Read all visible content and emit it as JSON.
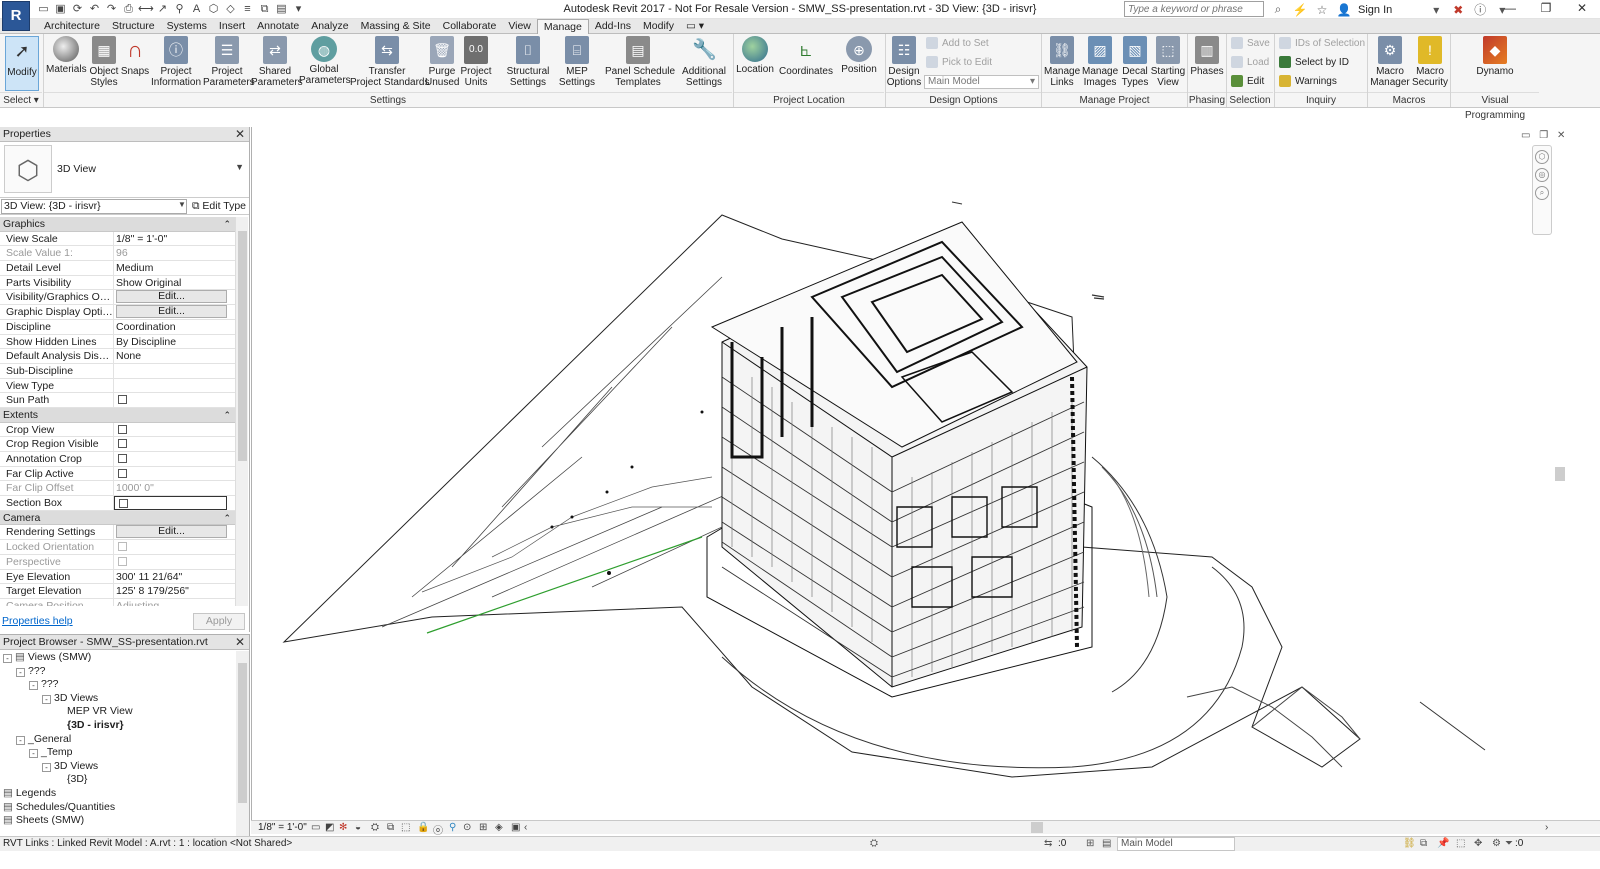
{
  "window": {
    "title": "Autodesk Revit 2017 - Not For Resale Version -    SMW_SS-presentation.rvt - 3D View: {3D - irisvr}",
    "search_placeholder": "Type a keyword or phrase",
    "sign_in": "Sign In",
    "app_button": "R"
  },
  "tabs": [
    "Architecture",
    "Structure",
    "Systems",
    "Insert",
    "Annotate",
    "Analyze",
    "Massing & Site",
    "Collaborate",
    "View",
    "Manage",
    "Add-Ins",
    "Modify"
  ],
  "active_tab": "Manage",
  "ribbon": {
    "modify": "Modify",
    "select": "Select",
    "settings_tools": [
      {
        "label1": "Materials",
        "label2": ""
      },
      {
        "label1": "Object",
        "label2": "Styles"
      },
      {
        "label1": "Snaps",
        "label2": ""
      },
      {
        "label1": "Project",
        "label2": "Information"
      },
      {
        "label1": "Project",
        "label2": "Parameters"
      },
      {
        "label1": "Shared",
        "label2": "Parameters"
      },
      {
        "label1": "Global",
        "label2": "Parameters"
      },
      {
        "label1": "Transfer",
        "label2": "Project Standards"
      },
      {
        "label1": "Purge",
        "label2": "Unused"
      },
      {
        "label1": "Project",
        "label2": "Units"
      },
      {
        "label1": "Structural",
        "label2": "Settings"
      },
      {
        "label1": "MEP",
        "label2": "Settings"
      },
      {
        "label1": "Panel Schedule",
        "label2": "Templates"
      },
      {
        "label1": "Additional",
        "label2": "Settings"
      }
    ],
    "location_tools": [
      {
        "label1": "Location",
        "label2": ""
      },
      {
        "label1": "Coordinates",
        "label2": ""
      },
      {
        "label1": "Position",
        "label2": ""
      }
    ],
    "design_options": {
      "label1": "Design",
      "label2": "Options",
      "add_to_set": "Add to Set",
      "pick_to_edit": "Pick to Edit",
      "main_model": "Main Model"
    },
    "manage_project_tools": [
      {
        "label1": "Manage",
        "label2": "Links"
      },
      {
        "label1": "Manage",
        "label2": "Images"
      },
      {
        "label1": "Decal",
        "label2": "Types"
      },
      {
        "label1": "Starting",
        "label2": "View"
      }
    ],
    "phases": "Phases",
    "selection": {
      "save": "Save",
      "load": "Load",
      "edit": "Edit"
    },
    "inquiry": {
      "ids": "IDs of Selection",
      "select_by_id": "Select by ID",
      "warnings": "Warnings"
    },
    "macros_tools": [
      {
        "label1": "Macro",
        "label2": "Manager"
      },
      {
        "label1": "Macro",
        "label2": "Security"
      }
    ],
    "dynamo": "Dynamo",
    "panels": {
      "settings": "Settings",
      "project_location": "Project Location",
      "design_options": "Design Options",
      "manage_project": "Manage Project",
      "phasing": "Phasing",
      "selection": "Selection",
      "inquiry": "Inquiry",
      "macros": "Macros",
      "visual_programming": "Visual Programming"
    }
  },
  "properties": {
    "title": "Properties",
    "type_name": "3D View",
    "instance": "3D View: {3D - irisvr}",
    "edit_type": "Edit Type",
    "groups": [
      {
        "name": "Graphics",
        "rows": [
          {
            "name": "View Scale",
            "value": "1/8\" = 1'-0\"",
            "kind": "text"
          },
          {
            "name": "Scale Value    1:",
            "value": "96",
            "kind": "text",
            "disabled": true
          },
          {
            "name": "Detail Level",
            "value": "Medium",
            "kind": "text"
          },
          {
            "name": "Parts Visibility",
            "value": "Show Original",
            "kind": "text"
          },
          {
            "name": "Visibility/Graphics Overri...",
            "value": "Edit...",
            "kind": "button"
          },
          {
            "name": "Graphic Display Options",
            "value": "Edit...",
            "kind": "button"
          },
          {
            "name": "Discipline",
            "value": "Coordination",
            "kind": "text"
          },
          {
            "name": "Show Hidden Lines",
            "value": "By Discipline",
            "kind": "text"
          },
          {
            "name": "Default Analysis Display ...",
            "value": "None",
            "kind": "text"
          },
          {
            "name": "Sub-Discipline",
            "value": "",
            "kind": "text"
          },
          {
            "name": "View Type",
            "value": "",
            "kind": "text"
          },
          {
            "name": "Sun Path",
            "value": "",
            "kind": "check"
          }
        ]
      },
      {
        "name": "Extents",
        "rows": [
          {
            "name": "Crop View",
            "value": "",
            "kind": "check"
          },
          {
            "name": "Crop Region Visible",
            "value": "",
            "kind": "check"
          },
          {
            "name": "Annotation Crop",
            "value": "",
            "kind": "check"
          },
          {
            "name": "Far Clip Active",
            "value": "",
            "kind": "check"
          },
          {
            "name": "Far Clip Offset",
            "value": "1000'  0\"",
            "kind": "text",
            "disabled": true
          },
          {
            "name": "Section Box",
            "value": "",
            "kind": "check-boxed"
          }
        ]
      },
      {
        "name": "Camera",
        "rows": [
          {
            "name": "Rendering Settings",
            "value": "Edit...",
            "kind": "button"
          },
          {
            "name": "Locked Orientation",
            "value": "",
            "kind": "check",
            "disabled": true
          },
          {
            "name": "Perspective",
            "value": "",
            "kind": "check",
            "disabled": true
          },
          {
            "name": "Eye Elevation",
            "value": "300'  11 21/64\"",
            "kind": "text"
          },
          {
            "name": "Target Elevation",
            "value": "125'  8 179/256\"",
            "kind": "text"
          },
          {
            "name": "Camera Position",
            "value": "Adjusting",
            "kind": "text",
            "disabled": true
          }
        ]
      }
    ],
    "help": "Properties help",
    "apply": "Apply"
  },
  "browser": {
    "title": "Project Browser - SMW_SS-presentation.rvt",
    "nodes": [
      {
        "label": "Views (SMW)",
        "depth": 0,
        "toggle": "-",
        "icon": true
      },
      {
        "label": "???",
        "depth": 1,
        "toggle": "-"
      },
      {
        "label": "???",
        "depth": 2,
        "toggle": "-"
      },
      {
        "label": "3D Views",
        "depth": 3,
        "toggle": "-"
      },
      {
        "label": "MEP VR View",
        "depth": 4,
        "toggle": ""
      },
      {
        "label": "{3D - irisvr}",
        "depth": 4,
        "toggle": "",
        "selected": true
      },
      {
        "label": "_General",
        "depth": 1,
        "toggle": "-"
      },
      {
        "label": "_Temp",
        "depth": 2,
        "toggle": "-"
      },
      {
        "label": "3D Views",
        "depth": 3,
        "toggle": "-"
      },
      {
        "label": "{3D}",
        "depth": 4,
        "toggle": ""
      },
      {
        "label": "Legends",
        "depth": 0,
        "toggle": "",
        "icon": true
      },
      {
        "label": "Schedules/Quantities",
        "depth": 0,
        "toggle": "",
        "icon": true
      },
      {
        "label": "Sheets (SMW)",
        "depth": 0,
        "toggle": "",
        "icon": true
      }
    ]
  },
  "viewbar": {
    "scale": "1/8\" = 1'-0\""
  },
  "status": {
    "text": "RVT Links : Linked Revit Model : A.rvt : 1 : location <Not Shared>",
    "zero": ":0",
    "model": "Main Model",
    "filter": ":0"
  },
  "colors": {
    "app_blue": "#2b5797",
    "active_tool_bg": "#cde4f7",
    "link_blue": "#0066cc",
    "green_line": "#2e9e2e"
  }
}
